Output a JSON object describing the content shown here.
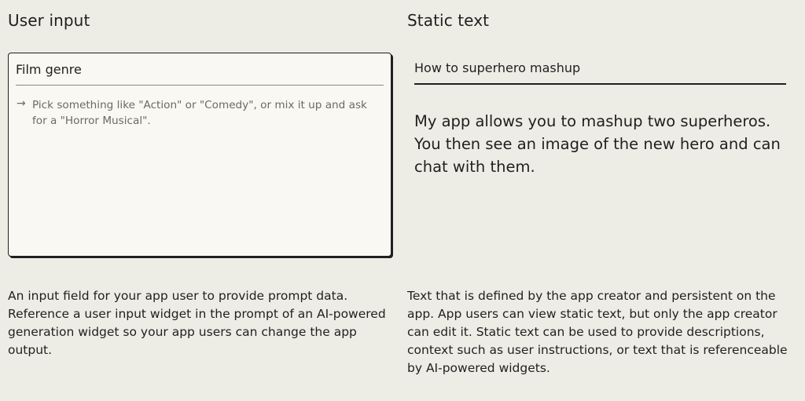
{
  "user_input": {
    "heading": "User input",
    "field_label": "Film genre",
    "hint_arrow": "→",
    "hint": "Pick something like \"Action\" or \"Comedy\", or mix it up and ask for a \"Horror Musical\".",
    "description": "An input field for your app user to provide prompt data. Reference a user input widget in the prompt of an AI-powered generation widget so your app users can change the app output."
  },
  "static_text": {
    "heading": "Static text",
    "title": "How to superhero mashup",
    "body": "My app allows you to mashup two superheros. You then see an image of the new hero and can chat with them.",
    "description": "Text that is defined by the app creator and persistent on the app. App users can view static text, but only the app creator can edit it. Static text can be used to provide descriptions, context such as user instructions, or text that is referenceable by AI-powered widgets."
  }
}
